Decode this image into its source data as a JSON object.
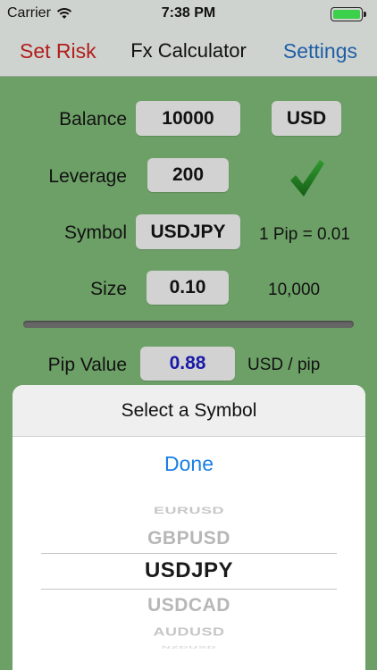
{
  "status_bar": {
    "carrier": "Carrier",
    "time": "7:38 PM"
  },
  "nav": {
    "left_label": "Set Risk",
    "title": "Fx Calculator",
    "right_label": "Settings"
  },
  "form": {
    "balance_label": "Balance",
    "balance_value": "10000",
    "currency": "USD",
    "leverage_label": "Leverage",
    "leverage_value": "200",
    "symbol_label": "Symbol",
    "symbol_value": "USDJPY",
    "pip_info": "1 Pip = 0.01",
    "size_label": "Size",
    "size_value": "0.10",
    "size_units": "10,000",
    "pip_value_label": "Pip Value",
    "pip_value": "0.88",
    "pip_value_unit": "USD / pip"
  },
  "picker_sheet": {
    "title": "Select a Symbol",
    "done_label": "Done",
    "options": [
      "EURUSD",
      "GBPUSD",
      "USDJPY",
      "USDCAD",
      "AUDUSD",
      "NZDUSD"
    ],
    "selected": "USDJPY"
  },
  "colors": {
    "background": "#6da067",
    "set_risk": "#b21d1d",
    "settings": "#1f5fa8",
    "pip_value": "#1a1aa8",
    "done": "#1a7fe6",
    "checkmark": "#1e7a1e"
  },
  "icons": {
    "wifi": "wifi-icon",
    "battery": "battery-icon",
    "check": "checkmark-icon"
  }
}
